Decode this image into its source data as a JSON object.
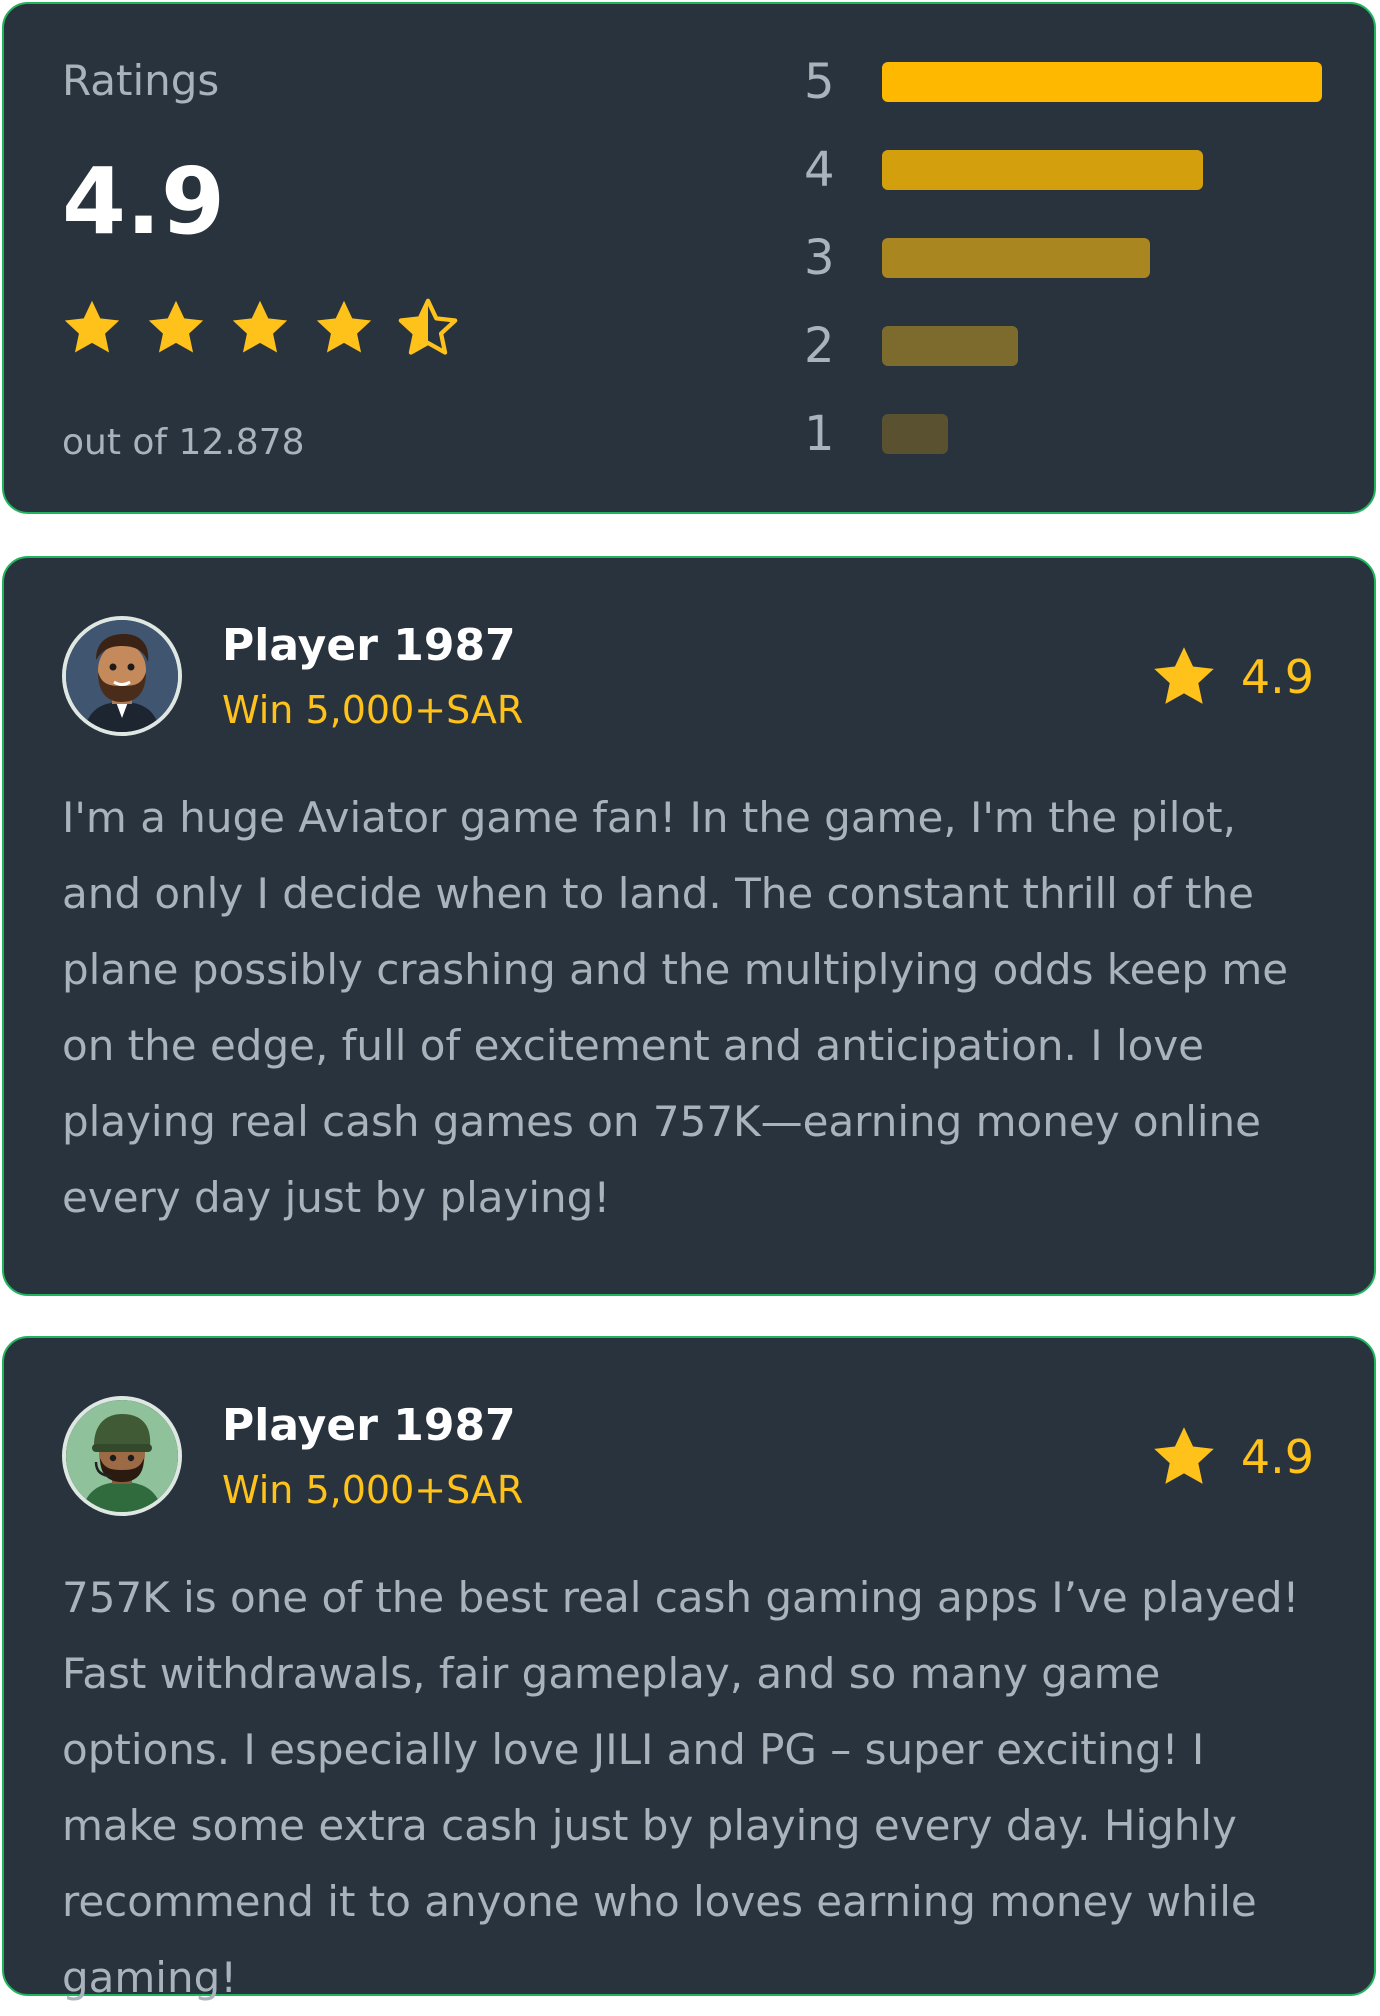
{
  "ratings": {
    "label": "Ratings",
    "score": "4.9",
    "stars_value": 4.5,
    "total_text": "out of 12.878",
    "distribution": [
      {
        "stars": "5",
        "fraction": 1.0,
        "color": "#ffb800"
      },
      {
        "stars": "4",
        "fraction": 0.73,
        "color": "#d39f0d"
      },
      {
        "stars": "3",
        "fraction": 0.61,
        "color": "#a98620"
      },
      {
        "stars": "2",
        "fraction": 0.31,
        "color": "#7c6b2d"
      },
      {
        "stars": "1",
        "fraction": 0.15,
        "color": "#5a5131"
      }
    ]
  },
  "reviews": [
    {
      "name": "Player 1987",
      "win": "Win 5,000+SAR",
      "rating": "4.9",
      "text": "I'm a huge Aviator game fan! In the game, I'm the pilot, and only I decide when to land. The constant thrill of the plane possibly crashing and the multiplying odds keep me on the edge, full of excitement and anticipation. I love playing real cash games on 757K—earning money online every day just by playing!"
    },
    {
      "name": "Player 1987",
      "win": "Win 5,000+SAR",
      "rating": "4.9",
      "text": "757K is one of the best real cash gaming apps I’ve played! Fast withdrawals, fair gameplay, and so many game options. I especially love JILI and PG – super exciting! I make some extra cash just by playing every day. Highly recommend it to anyone who loves earning money while gaming!"
    }
  ],
  "colors": {
    "card_bg": "#28333d",
    "card_border": "#22b35e",
    "accent": "#ffc21b",
    "muted_text": "#aab3bc"
  },
  "icons": {
    "star": "star-icon",
    "half_star": "half-star-icon",
    "avatar_1": "bearded-man-avatar",
    "avatar_2": "soldier-avatar"
  }
}
